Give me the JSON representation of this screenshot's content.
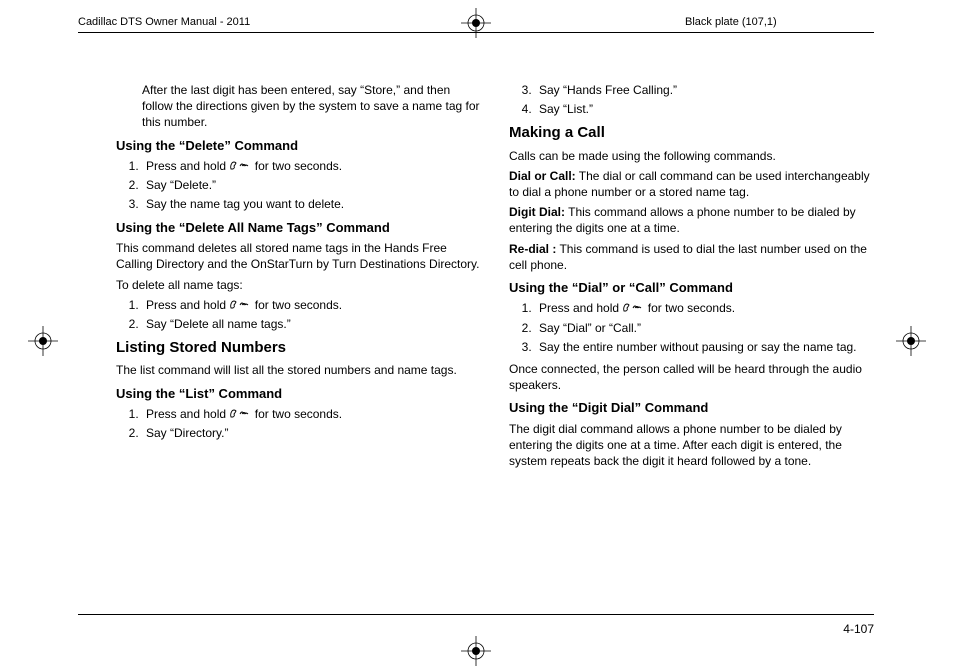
{
  "header": {
    "left": "Cadillac DTS Owner Manual - 2011",
    "right": "Black plate (107,1)"
  },
  "page_number": "4-107",
  "col1": {
    "intro_para": "After the last digit has been entered, say “Store,” and then follow the directions given by the system to save a name tag for this number.",
    "delete_cmd_heading": "Using the “Delete” Command",
    "delete_steps_1_pre": "Press and hold ",
    "delete_steps_1_post": " for two seconds.",
    "delete_steps_2": "Say “Delete.”",
    "delete_steps_3": "Say the name tag you want to delete.",
    "delete_all_heading": "Using the “Delete All Name Tags” Command",
    "delete_all_para": "This command deletes all stored name tags in the Hands Free Calling Directory and the OnStarTurn by Turn Destinations Directory.",
    "delete_all_lead": "To delete all name tags:",
    "delete_all_step1_pre": "Press and hold ",
    "delete_all_step1_post": " for two seconds.",
    "delete_all_step2": "Say “Delete all name tags.”",
    "listing_heading": "Listing Stored Numbers",
    "listing_para": "The list command will list all the stored numbers and name tags.",
    "list_cmd_heading": "Using the “List” Command",
    "list_step1_pre": "Press and hold ",
    "list_step1_post": " for two seconds.",
    "list_step2": "Say “Directory.”"
  },
  "col2": {
    "top_step3": "Say “Hands Free Calling.”",
    "top_step4": "Say “List.”",
    "making_call_heading": "Making a Call",
    "making_call_para": "Calls can be made using the following commands.",
    "dial_label": "Dial or Call:",
    "dial_text": " The dial or call command can be used interchangeably to dial a phone number or a stored name tag.",
    "digit_label": "Digit Dial:",
    "digit_text": " This command allows a phone number to be dialed by entering the digits one at a time.",
    "redial_label": "Re-dial :",
    "redial_text": " This command is used to dial the last number used on the cell phone.",
    "dial_cmd_heading": "Using the “Dial” or “Call” Command",
    "dial_step1_pre": "Press and hold ",
    "dial_step1_post": " for two seconds.",
    "dial_step2": "Say “Dial” or “Call.”",
    "dial_step3": "Say the entire number without pausing or say the name tag.",
    "dial_after": "Once connected, the person called will be heard through the audio speakers.",
    "digit_cmd_heading": "Using the “Digit Dial” Command",
    "digit_cmd_para": "The digit dial command allows a phone number to be dialed by entering the digits one at a time. After each digit is entered, the system repeats back the digit it heard followed by a tone."
  }
}
